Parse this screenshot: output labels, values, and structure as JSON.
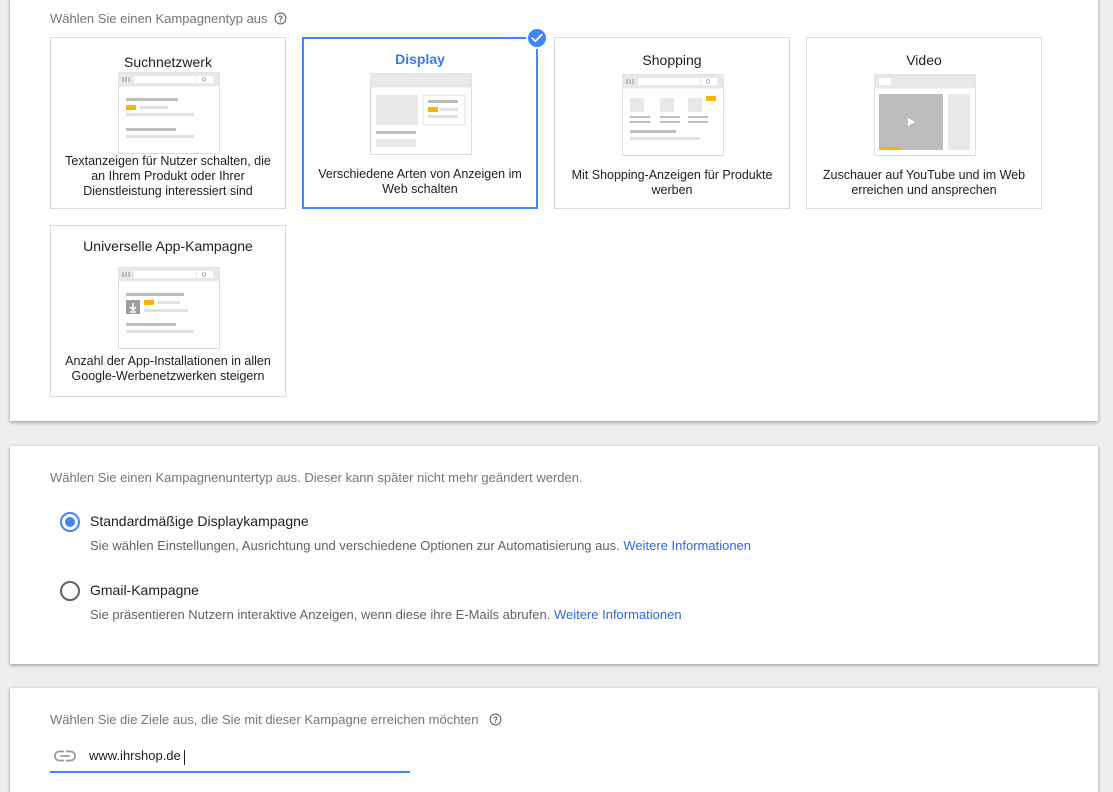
{
  "campaign_type": {
    "heading": "Wählen Sie einen Kampagnentyp aus",
    "cards": [
      {
        "title": "Suchnetzwerk",
        "description": "Textanzeigen für Nutzer schalten, die an Ihrem Produkt oder Ihrer Dienstleistung interessiert sind",
        "selected": false
      },
      {
        "title": "Display",
        "description": "Verschiedene Arten von Anzeigen im Web schalten",
        "selected": true
      },
      {
        "title": "Shopping",
        "description": "Mit Shopping-Anzeigen für Produkte werben",
        "selected": false
      },
      {
        "title": "Video",
        "description": "Zuschauer auf YouTube und im Web erreichen und ansprechen",
        "selected": false
      },
      {
        "title": "Universelle App-Kampagne",
        "description": "Anzahl der App-Installationen in allen Google-Werbenetzwerken steigern",
        "selected": false
      }
    ]
  },
  "subtype": {
    "heading": "Wählen Sie einen Kampagnenuntertyp aus. Dieser kann später nicht mehr geändert werden.",
    "options": [
      {
        "label": "Standardmäßige Displaykampagne",
        "description": "Sie wählen Einstellungen, Ausrichtung und verschiedene Optionen zur Automatisierung aus.",
        "link": "Weitere Informationen",
        "checked": true
      },
      {
        "label": "Gmail-Kampagne",
        "description": "Sie präsentieren Nutzern interaktive Anzeigen, wenn diese ihre E-Mails abrufen.",
        "link": "Weitere Informationen",
        "checked": false
      }
    ]
  },
  "goals": {
    "heading": "Wählen Sie die Ziele aus, die Sie mit dieser Kampagne erreichen möchten",
    "url_value": "www.ihrshop.de"
  },
  "colors": {
    "accent": "#4285f4",
    "link": "#3367d6",
    "highlight_yellow": "#f4b400"
  }
}
